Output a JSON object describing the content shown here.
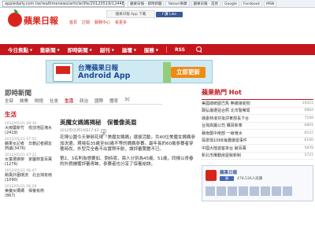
{
  "browser": {
    "url": "appledaily.com.tw/realtimenews/article/life/20120519/124484",
    "tabs": [
      "蘋果日報 - 即時新聞",
      "Yahoo!奇摩",
      "蘋果日報 - 首頁",
      "Google",
      "Facebook",
      "MSN"
    ]
  },
  "header": {
    "logo_text": "蘋果日報",
    "ad_text": "蘋果日報 App 下載",
    "fb_label": "f 讚 Like",
    "links": [
      "首頁",
      "訂閱",
      "服務中心",
      "看更多"
    ]
  },
  "nav": {
    "items": [
      "今日焦點",
      "動新聞",
      "即時新聞",
      "副刊",
      "論壇",
      "服務"
    ],
    "rss": "RSS"
  },
  "banner": {
    "title": "台灣蘋果日報",
    "subtitle": "Android App",
    "cta": "立即更新"
  },
  "section": {
    "title": "即時新聞",
    "subnav": [
      "全部",
      "娛樂",
      "財經",
      "社會",
      "生活",
      "政治",
      "國際",
      "體育",
      "3C"
    ]
  },
  "left": {
    "category": "生活",
    "items": [
      {
        "ts": "2012/05/21 08:30",
        "headline": "大雨襲新竹　低窪地區淹水(2419)"
      },
      {
        "ts": "2012/05/21 07:52",
        "headline": "蘋果女記者　日籍記者網友熱議(3476)"
      },
      {
        "ts": "2012/05/21 07:21",
        "headline": "女童遭綁架　家屬懸賞百萬(1276)"
      },
      {
        "ts": "2012/05/21 06:47",
        "headline": "颱風外圍環流　北台灣有雨(1090)"
      },
      {
        "ts": "2012/05/21 06:20",
        "headline": "美魔女媽媽　保養有術(867)"
      }
    ]
  },
  "article": {
    "title": "美魔女媽媽揭秘　保養像美眉",
    "date": "2012年05月19日17:43",
    "icon_label": "分享",
    "paragraphs": [
      "花博公園今天舉辦花現「美魔女媽媽」選拔活動，共40位美魔女媽媽參加決選，現場有35歲至60歲不等的媽媽參賽。最年長的60歲參賽者穿著時尚，外型完全看不出實際年齡，讓評審驚艷不已。",
      "第2、3名則為想要如、劉詩恩，兩人分別為45歲、51歲，同樣以青春的外貌擄獲評審青睞，參賽者也分享了保養祕訣。"
    ]
  },
  "hot": {
    "title_prefix": "蘋果熱門",
    "title_badge": "Hot",
    "rows": [
      {
        "t": "美國總統歐巴馬 無痛接受狗",
        "c": "10421"
      },
      {
        "t": "鄭弘儀遭拍合照 北市警察局",
        "c": "9864"
      },
      {
        "t": "綠委林淑芬批評某部長下台",
        "c": "7199"
      },
      {
        "t": "台灣高鐵公司 購買新車",
        "c": "6801"
      },
      {
        "t": "暴雨襲中南部 一線淹水",
        "c": "6537"
      },
      {
        "t": "翡翠灣1068海灘爆發事件",
        "c": "6166"
      },
      {
        "t": "中國大陸遊客來台 破百萬",
        "c": "5878"
      },
      {
        "t": "新北市推動房屋稅新制",
        "c": "5721"
      }
    ]
  },
  "fb_box": {
    "name": "蘋果日報",
    "like_label": "讚",
    "count": "478,536人說讚"
  }
}
